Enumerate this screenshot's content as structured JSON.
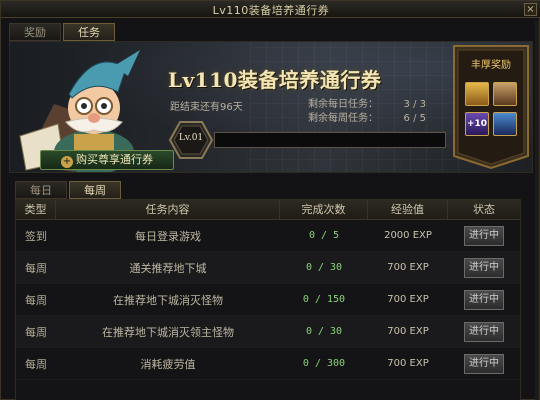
{
  "window": {
    "title": "Lv110装备培养通行券",
    "close_label": "×"
  },
  "top_tabs": [
    {
      "label": "奖励",
      "active": false
    },
    {
      "label": "任务",
      "active": true
    }
  ],
  "banner": {
    "pass_title": "Lv110装备培养通行券",
    "ends_in": "距结束还有96天",
    "daily_label": "剩余每日任务：",
    "daily_value": "3 / 3",
    "weekly_label": "剩余每周任务：",
    "weekly_value": "6 / 5",
    "level_label": "Lv.01",
    "progress": 0.0,
    "buy_button": "购买尊享通行券",
    "reward_title": "丰厚奖励",
    "reward_icons": [
      "gold-box-icon",
      "chest-icon",
      "amplify-plus10-icon",
      "sword-icon"
    ],
    "reward_icon_text": "+10"
  },
  "sub_tabs": [
    {
      "label": "每日",
      "active": false
    },
    {
      "label": "每周",
      "active": true
    }
  ],
  "table": {
    "headers": [
      "类型",
      "任务内容",
      "完成次数",
      "经验值",
      "状态"
    ],
    "rows": [
      {
        "type": "签到",
        "task": "每日登录游戏",
        "progress": "0 / 5",
        "exp": "2000 EXP",
        "status": "进行中"
      },
      {
        "type": "每周",
        "task": "通关推荐地下城",
        "progress": "0 / 30",
        "exp": "700 EXP",
        "status": "进行中"
      },
      {
        "type": "每周",
        "task": "在推荐地下城消灭怪物",
        "progress": "0 / 150",
        "exp": "700 EXP",
        "status": "进行中"
      },
      {
        "type": "每周",
        "task": "在推荐地下城消灭领主怪物",
        "progress": "0 / 30",
        "exp": "700 EXP",
        "status": "进行中"
      },
      {
        "type": "每周",
        "task": "消耗疲劳值",
        "progress": "0 / 300",
        "exp": "700 EXP",
        "status": "进行中"
      }
    ]
  },
  "colors": {
    "accent": "#f0c86b",
    "progress_green": "#8bd17a",
    "gold_border": "#c9a24a"
  }
}
